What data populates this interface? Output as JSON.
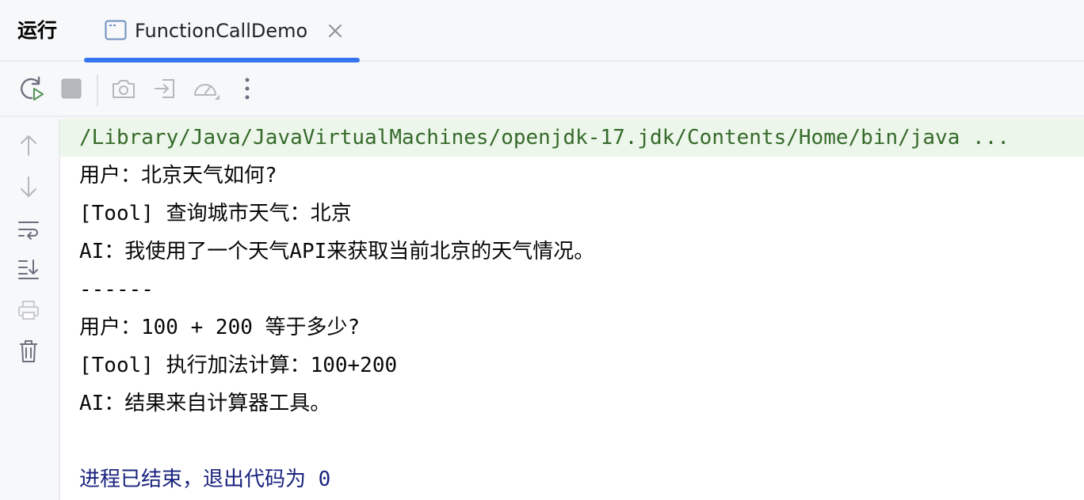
{
  "panel": {
    "title": "运行"
  },
  "tab": {
    "label": "FunctionCallDemo",
    "icon": "application-window-icon",
    "accent_color": "#3574f0"
  },
  "toolbar": {
    "items": [
      {
        "name": "rerun-button",
        "icon": "rerun-icon"
      },
      {
        "name": "stop-button",
        "icon": "stop-icon"
      },
      {
        "name": "screenshot-button",
        "icon": "camera-icon"
      },
      {
        "name": "login-button",
        "icon": "enter-icon"
      },
      {
        "name": "profile-button",
        "icon": "gauge-icon"
      },
      {
        "name": "more-button",
        "icon": "more-vertical-icon"
      }
    ]
  },
  "gutter": {
    "items": [
      {
        "name": "scroll-up-button",
        "icon": "arrow-up-icon"
      },
      {
        "name": "scroll-down-button",
        "icon": "arrow-down-icon"
      },
      {
        "name": "soft-wrap-button",
        "icon": "soft-wrap-icon"
      },
      {
        "name": "scroll-to-end-button",
        "icon": "scroll-to-end-icon"
      },
      {
        "name": "print-button",
        "icon": "printer-icon"
      },
      {
        "name": "clear-button",
        "icon": "trash-icon"
      }
    ]
  },
  "console": {
    "command": "/Library/Java/JavaVirtualMachines/openjdk-17.jdk/Contents/Home/bin/java ...",
    "lines": [
      "用户：北京天气如何?",
      "[Tool] 查询城市天气：北京",
      "AI：我使用了一个天气API来获取当前北京的天气情况。",
      "------",
      "用户：100 + 200 等于多少?",
      "[Tool] 执行加法计算：100+200",
      "AI：结果来自计算器工具。"
    ],
    "exit_message": "进程已结束，退出代码为 0",
    "colors": {
      "command": "#356a2b",
      "command_background": "#edf6ea",
      "exit_message": "#1a237e"
    }
  }
}
